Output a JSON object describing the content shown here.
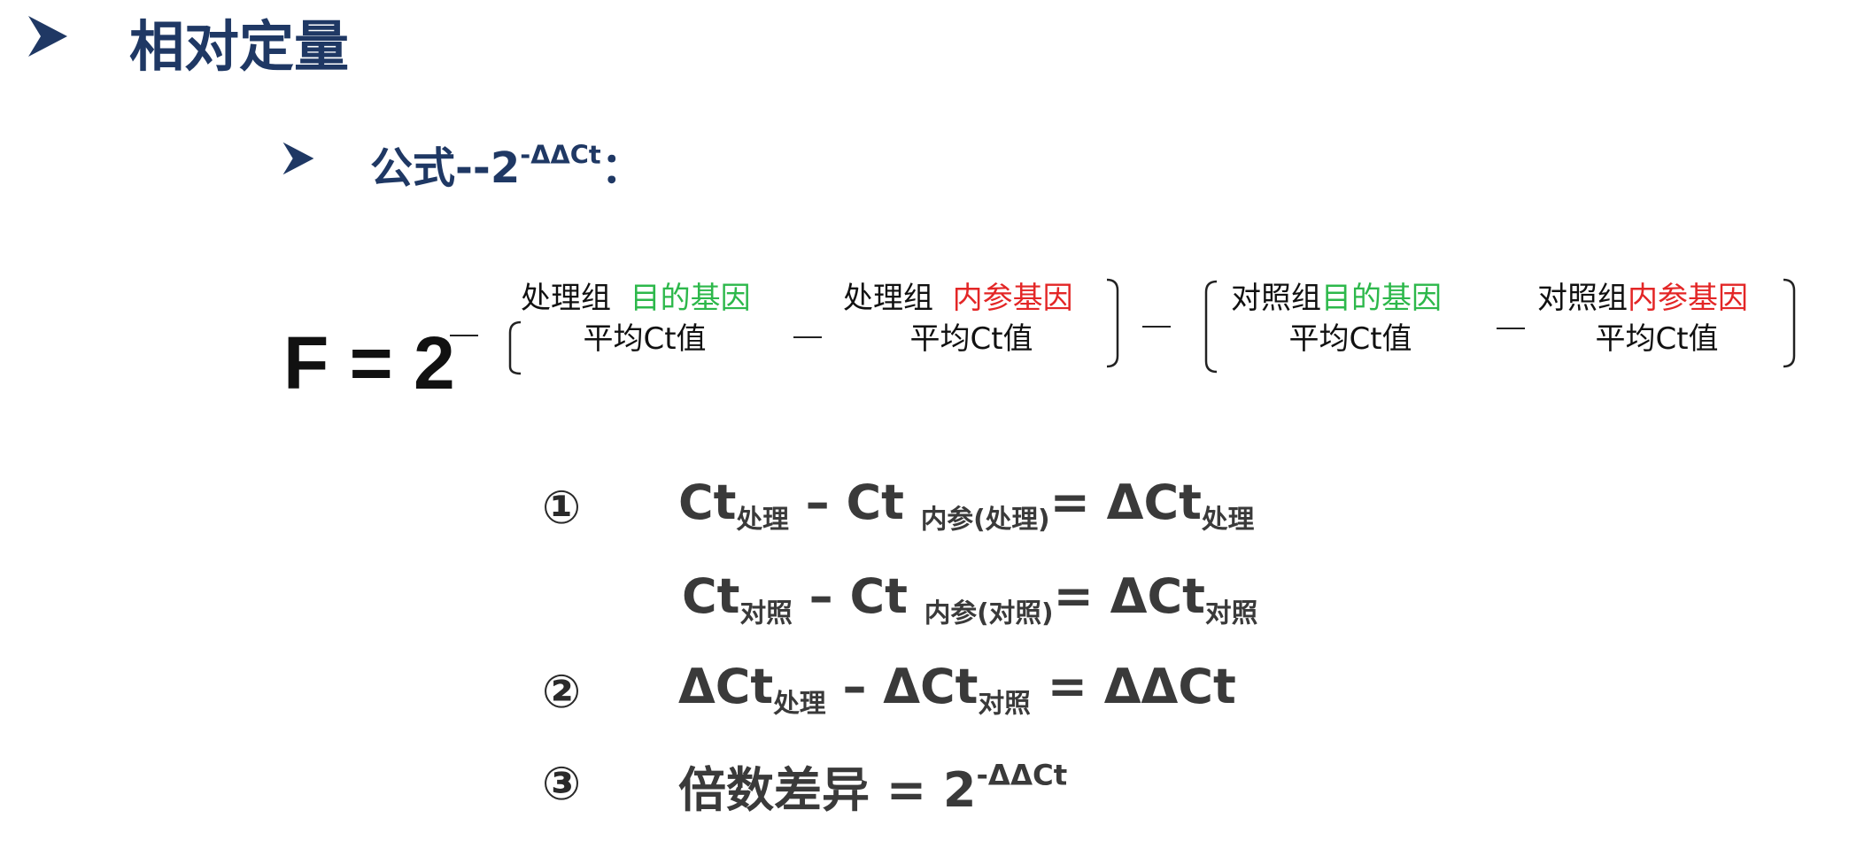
{
  "heading": {
    "title": "相对定量",
    "icon": "arrowhead-bullet-icon"
  },
  "subheading": {
    "text": "公式--2",
    "sup": "-ΔΔCt",
    "colon": "："
  },
  "formula": {
    "lhs": "F = 2",
    "cells": [
      {
        "prefix": "处理组",
        "gene": "目的基因",
        "gene_color": "#2db84b",
        "line2": "平均Ct值"
      },
      {
        "prefix": "处理组",
        "gene": "内参基因",
        "gene_color": "#e32626",
        "line2": "平均Ct值"
      },
      {
        "prefix": "对照组",
        "gene": "目的基因",
        "gene_color": "#2db84b",
        "line2": "平均Ct值"
      },
      {
        "prefix": "对照组",
        "gene": "内参基因",
        "gene_color": "#e32626",
        "line2": "平均Ct值"
      }
    ]
  },
  "steps": [
    {
      "num": "①",
      "a": "Ct",
      "a_sub": "处理",
      "minus": "–",
      "b": "Ct",
      "b_sub": "内参(处理)",
      "eq": "=",
      "c": "ΔCt",
      "c_sub": "处理"
    },
    {
      "num": "",
      "a": "Ct",
      "a_sub": "对照",
      "minus": "–",
      "b": "Ct",
      "b_sub": "内参(对照)",
      "eq": "=",
      "c": "ΔCt",
      "c_sub": "对照"
    },
    {
      "num": "②",
      "a": "ΔCt",
      "a_sub": "处理",
      "minus": "–",
      "b": "ΔCt",
      "b_sub": "对照",
      "eq": "=",
      "c": "ΔΔCt"
    },
    {
      "num": "③",
      "text": "倍数差异",
      "eq": "=",
      "c": "2",
      "c_sup": "-ΔΔCt"
    }
  ],
  "colors": {
    "navy": "#1f3864",
    "green": "#2db84b",
    "red": "#e32626",
    "text": "#3a3a3a"
  }
}
